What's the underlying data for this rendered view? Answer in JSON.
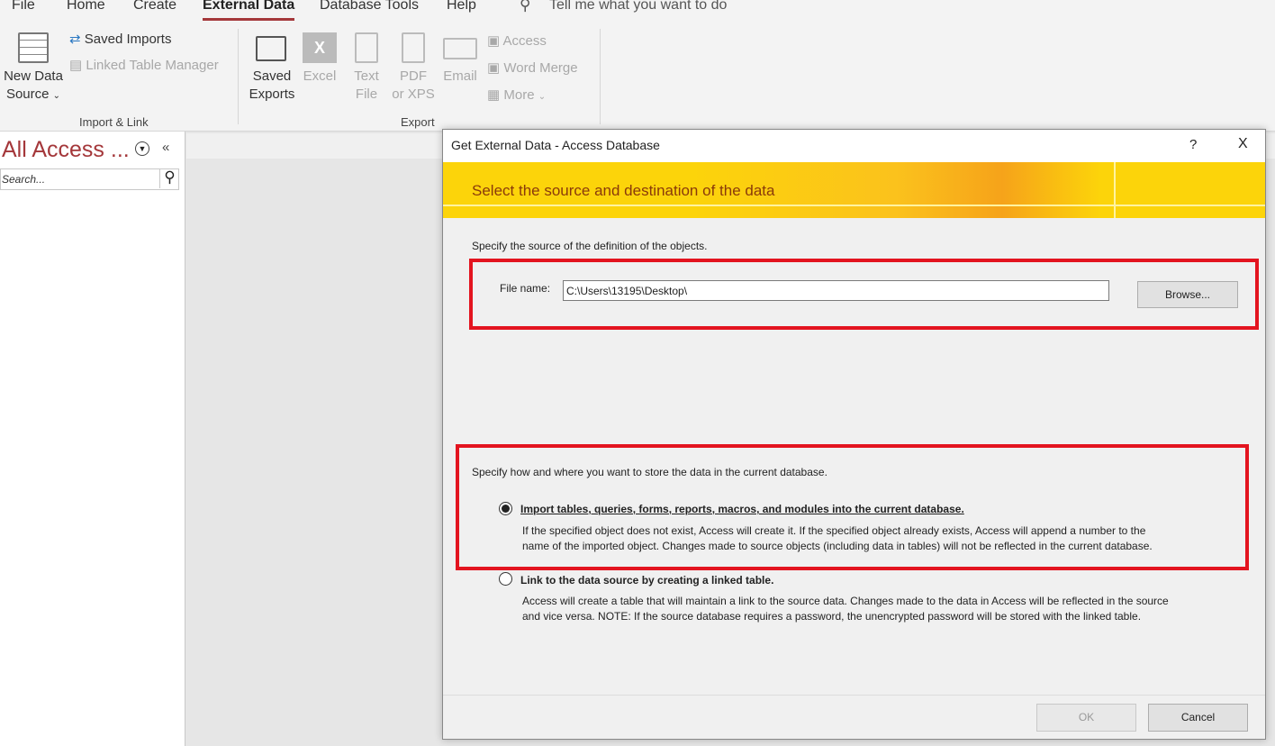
{
  "ribbon": {
    "tabs": [
      "File",
      "Home",
      "Create",
      "External Data",
      "Database Tools",
      "Help"
    ],
    "active_tab": "External Data",
    "tell_me": "Tell me what you want to do",
    "new_data_source": [
      "New Data",
      "Source"
    ],
    "saved_imports": "Saved Imports",
    "linked_table_manager": "Linked Table Manager",
    "import_link_group": "Import & Link",
    "saved_exports": [
      "Saved",
      "Exports"
    ],
    "excel": "Excel",
    "text_file": [
      "Text",
      "File"
    ],
    "pdf": [
      "PDF",
      "or XPS"
    ],
    "email": "Email",
    "access": "Access",
    "word_merge": "Word Merge",
    "more": "More",
    "export_group": "Export"
  },
  "nav": {
    "title": "All Access ...",
    "search_placeholder": "Search..."
  },
  "dialog": {
    "title": "Get External Data - Access Database",
    "help": "?",
    "close": "X",
    "banner": "Select the source and destination of the data",
    "source_prompt": "Specify the source of the definition of the objects.",
    "file_label": "File name:",
    "file_value": "C:\\Users\\13195\\Desktop\\",
    "browse": "Browse...",
    "store_prompt": "Specify how and where you want to store the data in the current database.",
    "options": [
      {
        "label": "Import tables, queries, forms, reports, macros, and modules into the current database.",
        "selected": true,
        "desc": [
          "If the specified object does not exist, Access will create it. If the specified object already exists, Access will append a number to the",
          "name of the imported object. Changes made to source objects (including data in tables) will not be reflected in the current database."
        ]
      },
      {
        "label": "Link to the data source by creating a linked table.",
        "selected": false,
        "desc": [
          "Access will create a table that will maintain a link to the source data. Changes made to the data in Access will be reflected in the source",
          "and vice versa. NOTE:  If the source database requires a password, the unencrypted password will be stored with the linked table."
        ]
      }
    ],
    "ok": "OK",
    "cancel": "Cancel"
  },
  "colors": {
    "accent": "#a4373a",
    "highlight": "#e3141f",
    "banner": "#fcd40a"
  }
}
